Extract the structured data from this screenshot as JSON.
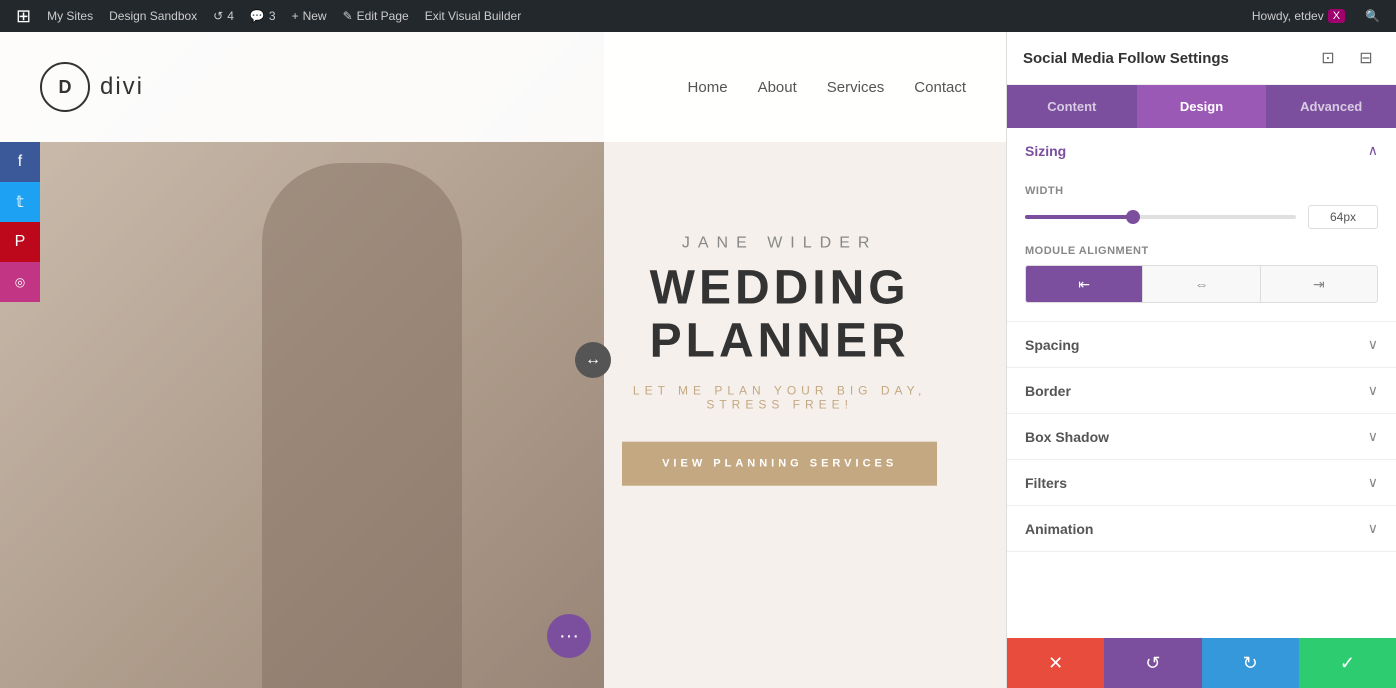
{
  "adminBar": {
    "wpIconLabel": "W",
    "mySites": "My Sites",
    "designSandbox": "Design Sandbox",
    "revisions": "4",
    "comments": "3",
    "new": "New",
    "editPage": "Edit Page",
    "exitVisualBuilder": "Exit Visual Builder",
    "howdy": "Howdy, etdev",
    "searchIcon": "🔍"
  },
  "siteHeader": {
    "logoLetter": "D",
    "logoText": "divi",
    "nav": {
      "home": "Home",
      "about": "About",
      "services": "Services",
      "contact": "Contact"
    }
  },
  "heroSection": {
    "name": "JANE WILDER",
    "title": "WEDDING PLANNER",
    "subtitle": "LET ME PLAN YOUR BIG DAY, STRESS FREE!",
    "ctaButton": "VIEW PLANNING SERVICES"
  },
  "socialSidebar": {
    "facebook": "f",
    "twitter": "t",
    "pinterest": "p",
    "instagram": "ig"
  },
  "settingsPanel": {
    "title": "Social Media Follow Settings",
    "collapseIcon": "⊡",
    "expandIcon": "⊞",
    "tabs": {
      "content": "Content",
      "design": "Design",
      "advanced": "Advanced"
    },
    "activeTab": "design",
    "sizing": {
      "sectionTitle": "Sizing",
      "widthLabel": "Width",
      "widthValue": "64px",
      "sliderPercent": 40,
      "moduleAlignmentLabel": "Module Alignment",
      "alignOptions": [
        "left",
        "center",
        "right"
      ],
      "activeAlign": "left"
    },
    "collapsedSections": [
      {
        "label": "Spacing"
      },
      {
        "label": "Border"
      },
      {
        "label": "Box Shadow"
      },
      {
        "label": "Filters"
      },
      {
        "label": "Animation"
      }
    ],
    "footer": {
      "cancel": "✕",
      "reset": "↺",
      "restore": "↻",
      "save": "✓"
    }
  }
}
